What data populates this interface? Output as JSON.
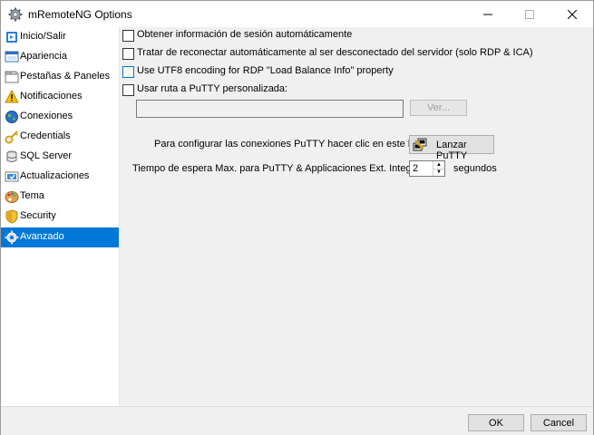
{
  "window": {
    "title": "mRemoteNG Options",
    "icon": "gear-icon"
  },
  "sidebar": {
    "items": [
      {
        "label": "Inicio/Salir",
        "icon": "startup-icon"
      },
      {
        "label": "Apariencia",
        "icon": "appearance-icon"
      },
      {
        "label": "Pestañas & Paneles",
        "icon": "tabs-icon"
      },
      {
        "label": "Notificaciones",
        "icon": "warning-icon"
      },
      {
        "label": "Conexiones",
        "icon": "globe-icon"
      },
      {
        "label": "Credentials",
        "icon": "key-icon"
      },
      {
        "label": "SQL Server",
        "icon": "database-icon"
      },
      {
        "label": "Actualizaciones",
        "icon": "update-icon"
      },
      {
        "label": "Tema",
        "icon": "palette-icon"
      },
      {
        "label": "Security",
        "icon": "shield-icon"
      },
      {
        "label": "Avanzado",
        "icon": "gear-icon",
        "selected": true
      }
    ]
  },
  "advanced": {
    "checkboxes": [
      {
        "label": "Obtener información de sesión automáticamente",
        "checked": false
      },
      {
        "label": "Tratar de reconectar automáticamente al ser desconectado del servidor (solo RDP & ICA)",
        "checked": false
      },
      {
        "label": "Use UTF8 encoding for RDP \"Load Balance Info\" property",
        "checked": false
      },
      {
        "label": "Usar ruta a PuTTY personalizada:",
        "checked": false
      }
    ],
    "putty_path_value": "",
    "browse_button": "Ver...",
    "launch_putty_label": "Para configurar las conexiones PuTTY hacer clic en este botón:",
    "launch_putty_button": "Lanzar PuTTY",
    "timeout_label": "Tiempo de espera Max. para PuTTY & Applicaciones Ext. Integradas:",
    "timeout_value": "2",
    "timeout_unit": "segundos"
  },
  "footer": {
    "ok": "OK",
    "cancel": "Cancel"
  },
  "colors": {
    "selection": "#0078d7",
    "accent": "#0078d7"
  }
}
